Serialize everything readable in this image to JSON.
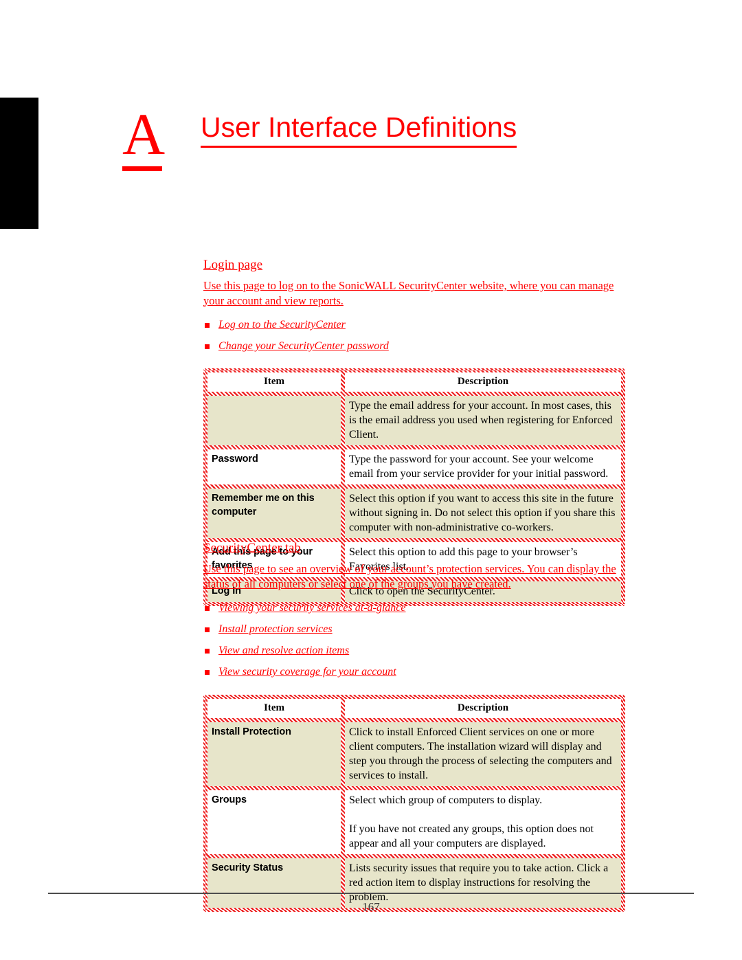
{
  "chapter": {
    "letter": "A",
    "title": "User Interface Definitions",
    "accent_color": "#ff0000",
    "thumb_tab_color": "#000000"
  },
  "sections": [
    {
      "heading": "Login page ",
      "intro": "Use this page to log on to the SonicWALL SecurityCenter website, where you can manage your account and view reports. ",
      "links": [
        "Log on to the SecurityCenter",
        "Change your SecurityCenter password"
      ],
      "table": {
        "headers": [
          "Item",
          "Description"
        ],
        "rows": [
          {
            "item": "",
            "description": [
              "Type the email address for your account. In most cases, this is the email address you used when registering for Enforced Client."
            ],
            "shade": "beige"
          },
          {
            "item": "Password",
            "description": [
              "Type the password for your account. See your welcome email from your service provider for your initial password."
            ],
            "shade": "white"
          },
          {
            "item": "Remember me on this computer",
            "description": [
              "Select this option if you want to access this site in the future without signing in. Do not select this option if you share this computer with non-administrative co-workers."
            ],
            "shade": "beige"
          },
          {
            "item": "Add this page to your favorites",
            "description": [
              "Select this option to add this page to your browser’s Favorites list."
            ],
            "shade": "white"
          },
          {
            "item": "Log In",
            "description": [
              "Click to open the SecurityCenter."
            ],
            "shade": "beige"
          }
        ]
      }
    },
    {
      "heading": "SecurityCenter tab ",
      "intro": "Use this page to see an overview of your account’s protection services. You can display the status of all computers or select one of the groups you have created. ",
      "links": [
        "Viewing your security services at-a-glance",
        "Install protection services",
        "View and resolve action items",
        "View security coverage for your account"
      ],
      "table": {
        "headers": [
          "Item",
          "Description"
        ],
        "rows": [
          {
            "item": "Install Protection",
            "description": [
              "Click to install Enforced Client services on one or more client computers. The installation wizard will display and step you through the process of selecting the computers and services to install."
            ],
            "shade": "beige"
          },
          {
            "item": "Groups",
            "description": [
              "Select which group of computers to display.",
              "If you have not created any groups, this option does not appear and all your computers are displayed."
            ],
            "shade": "white"
          },
          {
            "item": "Security Status",
            "description": [
              "Lists security issues that require you to take action. Click a red action item to display instructions for resolving the problem."
            ],
            "shade": "beige"
          }
        ]
      }
    }
  ],
  "footer": {
    "page_number": "167"
  }
}
